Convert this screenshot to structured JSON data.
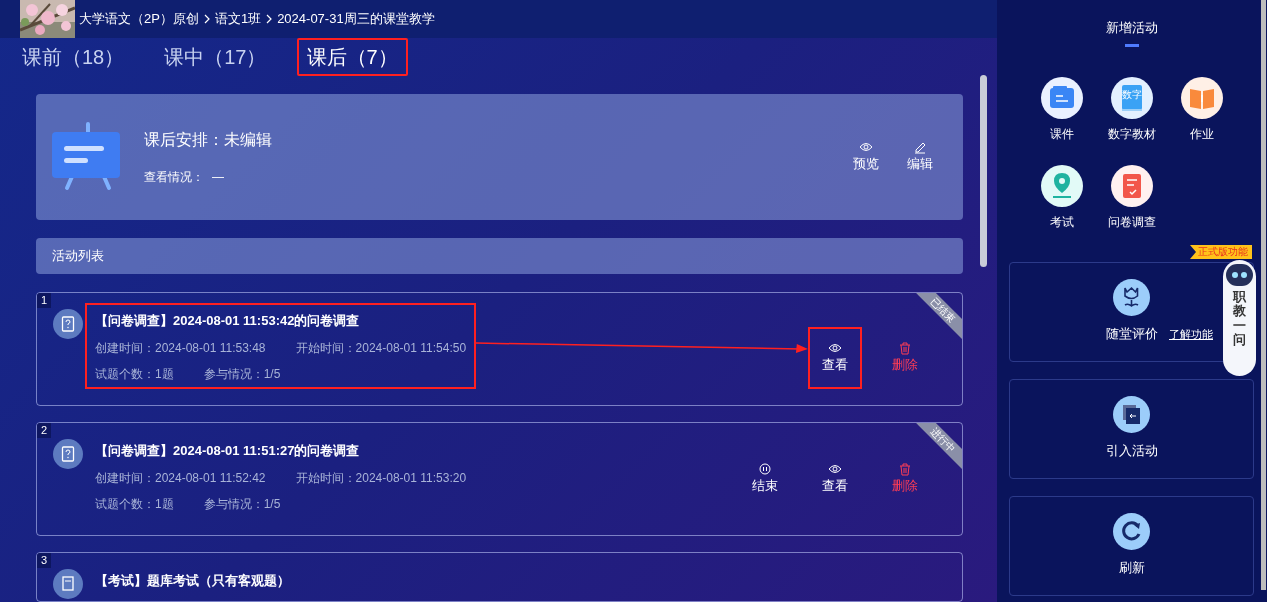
{
  "breadcrumb": {
    "parts": [
      "大学语文（2P）原创",
      "语文1班",
      "2024-07-31周三的课堂教学"
    ]
  },
  "tabs": [
    {
      "label": "课前（18）",
      "selected": false,
      "highlighted": false
    },
    {
      "label": "课中（17）",
      "selected": false,
      "highlighted": false
    },
    {
      "label": "课后（7）",
      "selected": true,
      "highlighted": true
    }
  ],
  "summary": {
    "title": "课后安排：未编辑",
    "status_label": "查看情况：",
    "status_value": "—",
    "actions": [
      {
        "kind": "preview",
        "label": "预览"
      },
      {
        "kind": "edit",
        "label": "编辑"
      }
    ]
  },
  "activity_list": {
    "title": "活动列表",
    "items": [
      {
        "index": "1",
        "kind": "survey",
        "title": "【问卷调查】2024-08-01 11:53:42的问卷调查",
        "created": "创建时间：2024-08-01 11:53:48",
        "started": "开始时间：2024-08-01 11:54:50",
        "questions": "试题个数：1题",
        "participation": "参与情况：1/5",
        "status": "已结束",
        "highlighted": true,
        "actions": [
          {
            "kind": "view",
            "label": "查看",
            "highlighted": true
          },
          {
            "kind": "delete",
            "label": "删除",
            "highlighted": false
          }
        ]
      },
      {
        "index": "2",
        "kind": "survey",
        "title": "【问卷调查】2024-08-01 11:51:27的问卷调查",
        "created": "创建时间：2024-08-01 11:52:42",
        "started": "开始时间：2024-08-01 11:53:20",
        "questions": "试题个数：1题",
        "participation": "参与情况：1/5",
        "status": "进行中",
        "highlighted": false,
        "actions": [
          {
            "kind": "end",
            "label": "结束",
            "highlighted": false
          },
          {
            "kind": "view",
            "label": "查看",
            "highlighted": false
          },
          {
            "kind": "delete",
            "label": "删除",
            "highlighted": false
          }
        ]
      },
      {
        "index": "3",
        "kind": "exam",
        "title": "【考试】题库考试（只有客观题）"
      }
    ]
  },
  "sidebar": {
    "title": "新增活动",
    "tiles": [
      {
        "kind": "courseware",
        "label": "课件"
      },
      {
        "kind": "textbook",
        "label": "数字教材",
        "icon_text": "数字"
      },
      {
        "kind": "homework",
        "label": "作业"
      },
      {
        "kind": "exam",
        "label": "考试"
      },
      {
        "kind": "survey",
        "label": "问卷调查"
      }
    ],
    "panels": [
      {
        "kind": "evaluation",
        "label": "随堂评价",
        "link": "了解功能"
      },
      {
        "kind": "import",
        "label": "引入活动"
      },
      {
        "kind": "refresh",
        "label": "刷新"
      }
    ]
  },
  "assistant": {
    "badge": "正式版功能",
    "label": "职教一问"
  }
}
